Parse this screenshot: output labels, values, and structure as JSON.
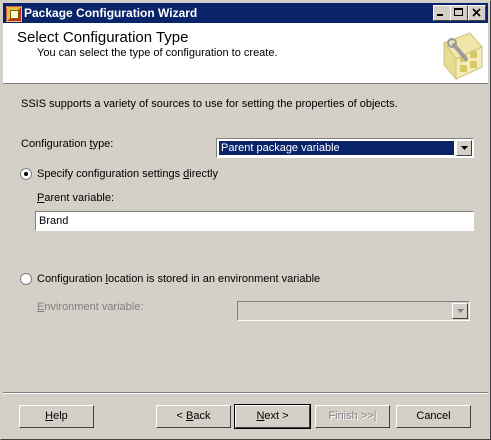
{
  "window": {
    "title": "Package Configuration Wizard",
    "controls": {
      "minimize": "_",
      "maximize": "□",
      "close": "×"
    }
  },
  "header": {
    "title": "Select Configuration Type",
    "subtitle": "You can select the type of configuration to create."
  },
  "intro": "SSIS supports a variety of sources to use for setting the properties of objects.",
  "config_type": {
    "label_pre": "Configuration ",
    "label_u": "t",
    "label_post": "ype:",
    "value": "Parent package variable"
  },
  "option_direct": {
    "label_pre": "Specify configuration settings ",
    "label_u": "d",
    "label_post": "irectly",
    "selected": true
  },
  "parent_variable": {
    "label_u": "P",
    "label_post": "arent variable:",
    "value": "Brand"
  },
  "option_env": {
    "label_pre": "Configuration ",
    "label_u": "l",
    "label_post": "ocation is stored in an environment variable",
    "selected": false
  },
  "env_variable": {
    "label_u": "E",
    "label_post": "nvironment variable:",
    "value": ""
  },
  "buttons": {
    "help_u": "H",
    "help_post": "elp",
    "back_pre": "< ",
    "back_u": "B",
    "back_post": "ack",
    "next_u": "N",
    "next_post": "ext >",
    "finish": "Finish >>|",
    "cancel": "Cancel"
  }
}
